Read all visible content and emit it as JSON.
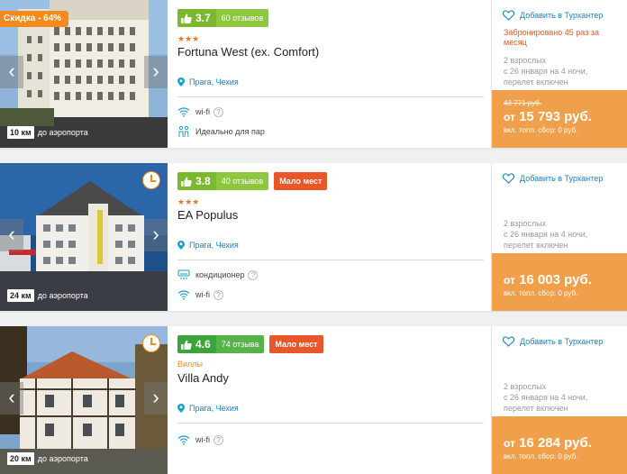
{
  "cards": [
    {
      "discount": "Скидка - 64%",
      "distance_km": "10 км",
      "distance_label": "до аэропорта",
      "rating": "3.7",
      "reviews": "60 отзывов",
      "few_places": "",
      "stars": "★★★",
      "category": "",
      "name": "Fortuna West (ex. Comfort)",
      "location": "Прага, Чехия",
      "amenities": [
        "wi-fi",
        "Идеально для пар"
      ],
      "favorite": "Добавить в Турхантер",
      "booked": "Забронировано 45 раз за месяц",
      "tour": [
        "2 взрослых",
        "с 26 января на 4 ночи,",
        "перелет включен"
      ],
      "old_price": "43 771 руб.",
      "price_prefix": "от",
      "price": "15 793 руб.",
      "fees": "вкл. топл. сбор: 0 руб."
    },
    {
      "discount": "",
      "distance_km": "24 км",
      "distance_label": "до аэропорта",
      "rating": "3.8",
      "reviews": "40 отзывов",
      "few_places": "Мало мест",
      "stars": "★★★",
      "category": "",
      "name": "EA Populus",
      "location": "Прага, Чехия",
      "amenities": [
        "кондиционер",
        "wi-fi"
      ],
      "favorite": "Добавить в Турхантер",
      "booked": "",
      "tour": [
        "2 взрослых",
        "с 26 января на 4 ночи,",
        "перелет включен"
      ],
      "old_price": "",
      "price_prefix": "от",
      "price": "16 003 руб.",
      "fees": "вкл. топл. сбор: 0 руб."
    },
    {
      "discount": "",
      "distance_km": "20 км",
      "distance_label": "до аэропорта",
      "rating": "4.6",
      "reviews": "74 отзыва",
      "few_places": "Мало мест",
      "stars": "",
      "category": "Виллы",
      "name": "Villa Andy",
      "location": "Прага, Чехия",
      "amenities": [
        "wi-fi"
      ],
      "favorite": "Добавить в Турхантер",
      "booked": "",
      "tour": [
        "2 взрослых",
        "с 26 января на 4 ночи,",
        "перелет включен"
      ],
      "old_price": "",
      "price_prefix": "от",
      "price": "16 284 руб.",
      "fees": "вкл. топл. сбор: 0 руб."
    }
  ],
  "colors": {
    "accent_orange": "#f28a1e",
    "price_bg": "#f0a04a",
    "rating_green": "#7cb82f",
    "rating_green_dark": "#3ca43c",
    "few_places_red": "#e8562a",
    "link_blue": "#1a7fbf"
  },
  "icons": {
    "arrow_left": "‹",
    "arrow_right": "›",
    "help": "?"
  }
}
